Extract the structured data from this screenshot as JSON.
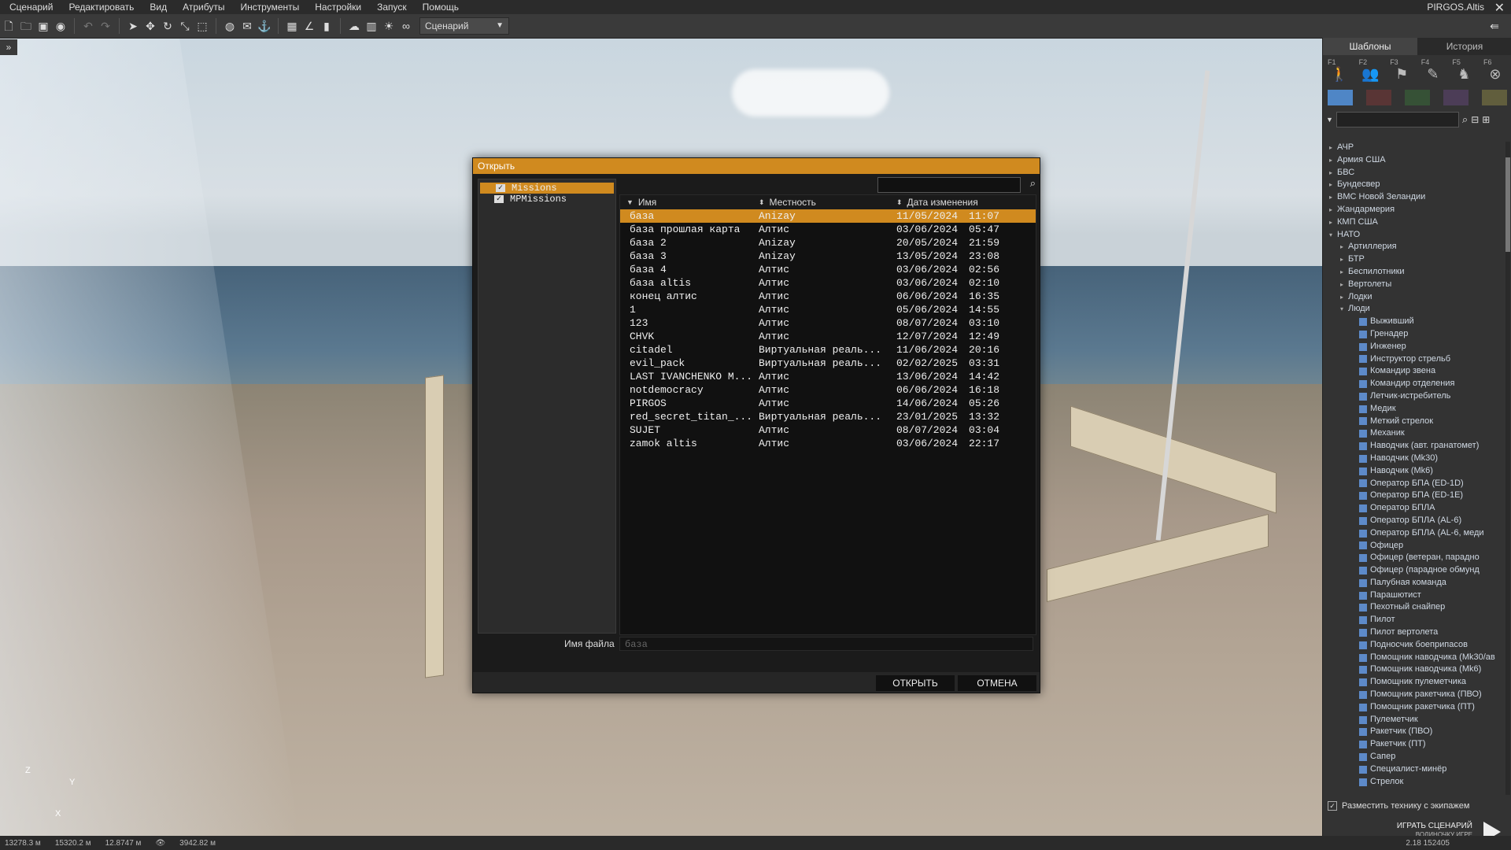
{
  "menubar": {
    "items": [
      "Сценарий",
      "Редактировать",
      "Вид",
      "Атрибуты",
      "Инструменты",
      "Настройки",
      "Запуск",
      "Помощь"
    ],
    "world": "PIRGOS.Altis"
  },
  "toolbar": {
    "mode": "Сценарий"
  },
  "dialog": {
    "title": "Открыть",
    "folders": [
      "Missions",
      "MPMissions"
    ],
    "columns": {
      "name": "Имя",
      "terrain": "Местность",
      "date": "Дата изменения"
    },
    "files": [
      {
        "name": "база",
        "terrain": "Anizay",
        "date": "11/05/2024",
        "time": "11:07"
      },
      {
        "name": "база прошлая карта",
        "terrain": "Алтис",
        "date": "03/06/2024",
        "time": "05:47"
      },
      {
        "name": "база 2",
        "terrain": "Anizay",
        "date": "20/05/2024",
        "time": "21:59"
      },
      {
        "name": "база 3",
        "terrain": "Anizay",
        "date": "13/05/2024",
        "time": "23:08"
      },
      {
        "name": "база 4",
        "terrain": "Алтис",
        "date": "03/06/2024",
        "time": "02:56"
      },
      {
        "name": "база altis",
        "terrain": "Алтис",
        "date": "03/06/2024",
        "time": "02:10"
      },
      {
        "name": "конец алтис",
        "terrain": "Алтис",
        "date": "06/06/2024",
        "time": "16:35"
      },
      {
        "name": "1",
        "terrain": "Алтис",
        "date": "05/06/2024",
        "time": "14:55"
      },
      {
        "name": "123",
        "terrain": "Алтис",
        "date": "08/07/2024",
        "time": "03:10"
      },
      {
        "name": "CHVK",
        "terrain": "Алтис",
        "date": "12/07/2024",
        "time": "12:49"
      },
      {
        "name": "citadel",
        "terrain": "Виртуальная реаль...",
        "date": "11/06/2024",
        "time": "20:16"
      },
      {
        "name": "evil_pack",
        "terrain": "Виртуальная реаль...",
        "date": "02/02/2025",
        "time": "03:31"
      },
      {
        "name": "LAST IVANCHENKO M...",
        "terrain": "Алтис",
        "date": "13/06/2024",
        "time": "14:42"
      },
      {
        "name": "notdemocracy",
        "terrain": "Алтис",
        "date": "06/06/2024",
        "time": "16:18"
      },
      {
        "name": "PIRGOS",
        "terrain": "Алтис",
        "date": "14/06/2024",
        "time": "05:26"
      },
      {
        "name": "red_secret_titan_...",
        "terrain": "Виртуальная реаль...",
        "date": "23/01/2025",
        "time": "13:32"
      },
      {
        "name": "SUJET",
        "terrain": "Алтис",
        "date": "08/07/2024",
        "time": "03:04"
      },
      {
        "name": "zamok altis",
        "terrain": "Алтис",
        "date": "03/06/2024",
        "time": "22:17"
      }
    ],
    "filename_label": "Имя файла",
    "filename_value": "база",
    "open_label": "ОТКРЫТЬ",
    "cancel_label": "ОТМЕНА"
  },
  "right_panel": {
    "tabs": [
      "Шаблоны",
      "История"
    ],
    "fkeys": [
      "F1",
      "F2",
      "F3",
      "F4",
      "F5",
      "F6"
    ],
    "swatches": [
      "#4f86c6",
      "#a03a3a",
      "#3c8a3c",
      "#7a4f9a",
      "#b8b050"
    ],
    "tree": [
      {
        "label": "АЧР",
        "level": 0,
        "arrow": "▸"
      },
      {
        "label": "Армия США",
        "level": 0,
        "arrow": "▸"
      },
      {
        "label": "БВС",
        "level": 0,
        "arrow": "▸"
      },
      {
        "label": "Бундесвер",
        "level": 0,
        "arrow": "▸"
      },
      {
        "label": "ВМС Новой Зеландии",
        "level": 0,
        "arrow": "▸"
      },
      {
        "label": "Жандармерия",
        "level": 0,
        "arrow": "▸"
      },
      {
        "label": "КМП США",
        "level": 0,
        "arrow": "▸"
      },
      {
        "label": "НАТО",
        "level": 0,
        "arrow": "▾"
      },
      {
        "label": "Артиллерия",
        "level": 1,
        "arrow": "▸"
      },
      {
        "label": "БТР",
        "level": 1,
        "arrow": "▸"
      },
      {
        "label": "Беспилотники",
        "level": 1,
        "arrow": "▸"
      },
      {
        "label": "Вертолеты",
        "level": 1,
        "arrow": "▸"
      },
      {
        "label": "Лодки",
        "level": 1,
        "arrow": "▸"
      },
      {
        "label": "Люди",
        "level": 1,
        "arrow": "▾"
      },
      {
        "label": "Выживший",
        "level": 2,
        "arrow": ""
      },
      {
        "label": "Гренадер",
        "level": 2,
        "arrow": ""
      },
      {
        "label": "Инженер",
        "level": 2,
        "arrow": ""
      },
      {
        "label": "Инструктор стрельб",
        "level": 2,
        "arrow": ""
      },
      {
        "label": "Командир звена",
        "level": 2,
        "arrow": ""
      },
      {
        "label": "Командир отделения",
        "level": 2,
        "arrow": ""
      },
      {
        "label": "Летчик-истребитель",
        "level": 2,
        "arrow": ""
      },
      {
        "label": "Медик",
        "level": 2,
        "arrow": ""
      },
      {
        "label": "Меткий стрелок",
        "level": 2,
        "arrow": ""
      },
      {
        "label": "Механик",
        "level": 2,
        "arrow": ""
      },
      {
        "label": "Наводчик (авт. гранатомет)",
        "level": 2,
        "arrow": ""
      },
      {
        "label": "Наводчик (Mk30)",
        "level": 2,
        "arrow": ""
      },
      {
        "label": "Наводчик (Mk6)",
        "level": 2,
        "arrow": ""
      },
      {
        "label": "Оператор БПА (ED-1D)",
        "level": 2,
        "arrow": ""
      },
      {
        "label": "Оператор БПА (ED-1E)",
        "level": 2,
        "arrow": ""
      },
      {
        "label": "Оператор БПЛА",
        "level": 2,
        "arrow": ""
      },
      {
        "label": "Оператор БПЛА (AL-6)",
        "level": 2,
        "arrow": ""
      },
      {
        "label": "Оператор БПЛА (AL-6, меди",
        "level": 2,
        "arrow": ""
      },
      {
        "label": "Офицер",
        "level": 2,
        "arrow": ""
      },
      {
        "label": "Офицер (ветеран, парадно",
        "level": 2,
        "arrow": ""
      },
      {
        "label": "Офицер (парадное обмунд",
        "level": 2,
        "arrow": ""
      },
      {
        "label": "Палубная команда",
        "level": 2,
        "arrow": ""
      },
      {
        "label": "Парашютист",
        "level": 2,
        "arrow": ""
      },
      {
        "label": "Пехотный снайпер",
        "level": 2,
        "arrow": ""
      },
      {
        "label": "Пилот",
        "level": 2,
        "arrow": ""
      },
      {
        "label": "Пилот вертолета",
        "level": 2,
        "arrow": ""
      },
      {
        "label": "Подносчик боеприпасов",
        "level": 2,
        "arrow": ""
      },
      {
        "label": "Помощник наводчика (Mk30/ав",
        "level": 2,
        "arrow": ""
      },
      {
        "label": "Помощник наводчика (Mk6)",
        "level": 2,
        "arrow": ""
      },
      {
        "label": "Помощник пулеметчика",
        "level": 2,
        "arrow": ""
      },
      {
        "label": "Помощник ракетчика (ПВО)",
        "level": 2,
        "arrow": ""
      },
      {
        "label": "Помощник ракетчика (ПТ)",
        "level": 2,
        "arrow": ""
      },
      {
        "label": "Пулеметчик",
        "level": 2,
        "arrow": ""
      },
      {
        "label": "Ракетчик (ПВО)",
        "level": 2,
        "arrow": ""
      },
      {
        "label": "Ракетчик (ПТ)",
        "level": 2,
        "arrow": ""
      },
      {
        "label": "Сапер",
        "level": 2,
        "arrow": ""
      },
      {
        "label": "Специалист-минёр",
        "level": 2,
        "arrow": ""
      },
      {
        "label": "Стрелок",
        "level": 2,
        "arrow": ""
      }
    ],
    "crew_checkbox": "Разместить технику с экипажем",
    "play_label": "ИГРАТЬ СЦЕНАРИЙ",
    "play_sub": "ВОДИНОЧКУ ИГРЕ"
  },
  "statusbar": {
    "x": "13278.3 м",
    "y": "15320.2 м",
    "z": "12.8747 м",
    "view": "3942.82 м",
    "right": "2.18 152405"
  },
  "scene": {
    "axis_z": "Z",
    "axis_y": "Y",
    "axis_x": "X"
  }
}
